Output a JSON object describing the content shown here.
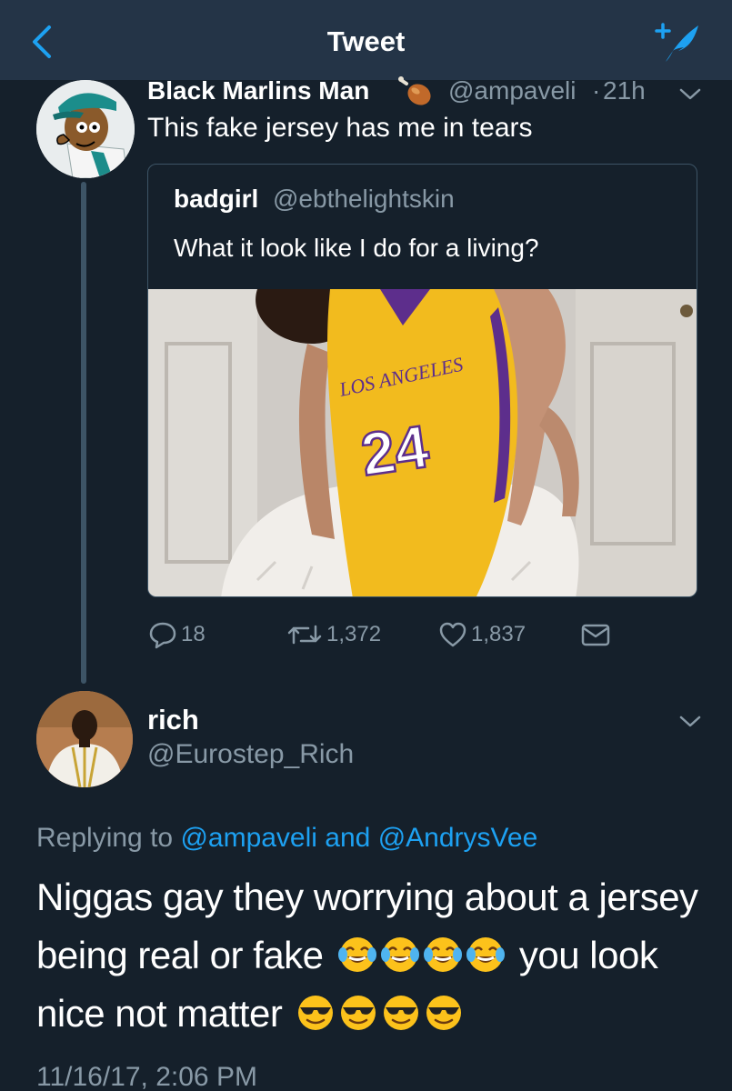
{
  "header": {
    "title": "Tweet",
    "back_icon": "chevron-left-icon",
    "compose_icon": "compose-tweet-icon"
  },
  "tweet1": {
    "name": "Black Marlins Man",
    "name_emoji": "poultry-leg",
    "handle": "@ampaveli",
    "dot": "·",
    "time": "21h",
    "text": "This fake jersey has me in tears",
    "quote": {
      "name": "badgirl",
      "handle": "@ebthelightskin",
      "text": "What it look like I do for a living?"
    },
    "actions": {
      "reply_count": "18",
      "retweet_count": "1,372",
      "like_count": "1,837"
    }
  },
  "tweet2": {
    "name": "rich",
    "handle": "@Eurostep_Rich",
    "replying_prefix": "Replying to",
    "replying_user1": "@ampaveli",
    "replying_and": "and",
    "replying_user2": "@AndrysVee",
    "text_line1": "Niggas gay they worrying about a jersey",
    "text_part2": "being real or fake",
    "text_part3": "you look",
    "text_part4": "nice not matter",
    "emoji_laugh": "face-with-tears-of-joy",
    "emoji_cool": "smiling-face-with-sunglasses",
    "date": "11/16/17, 2:06 PM"
  },
  "colors": {
    "background": "#15202b",
    "header": "#243447",
    "accent": "#1da1f2",
    "secondary_text": "#8899a6",
    "border": "#3d5466"
  }
}
